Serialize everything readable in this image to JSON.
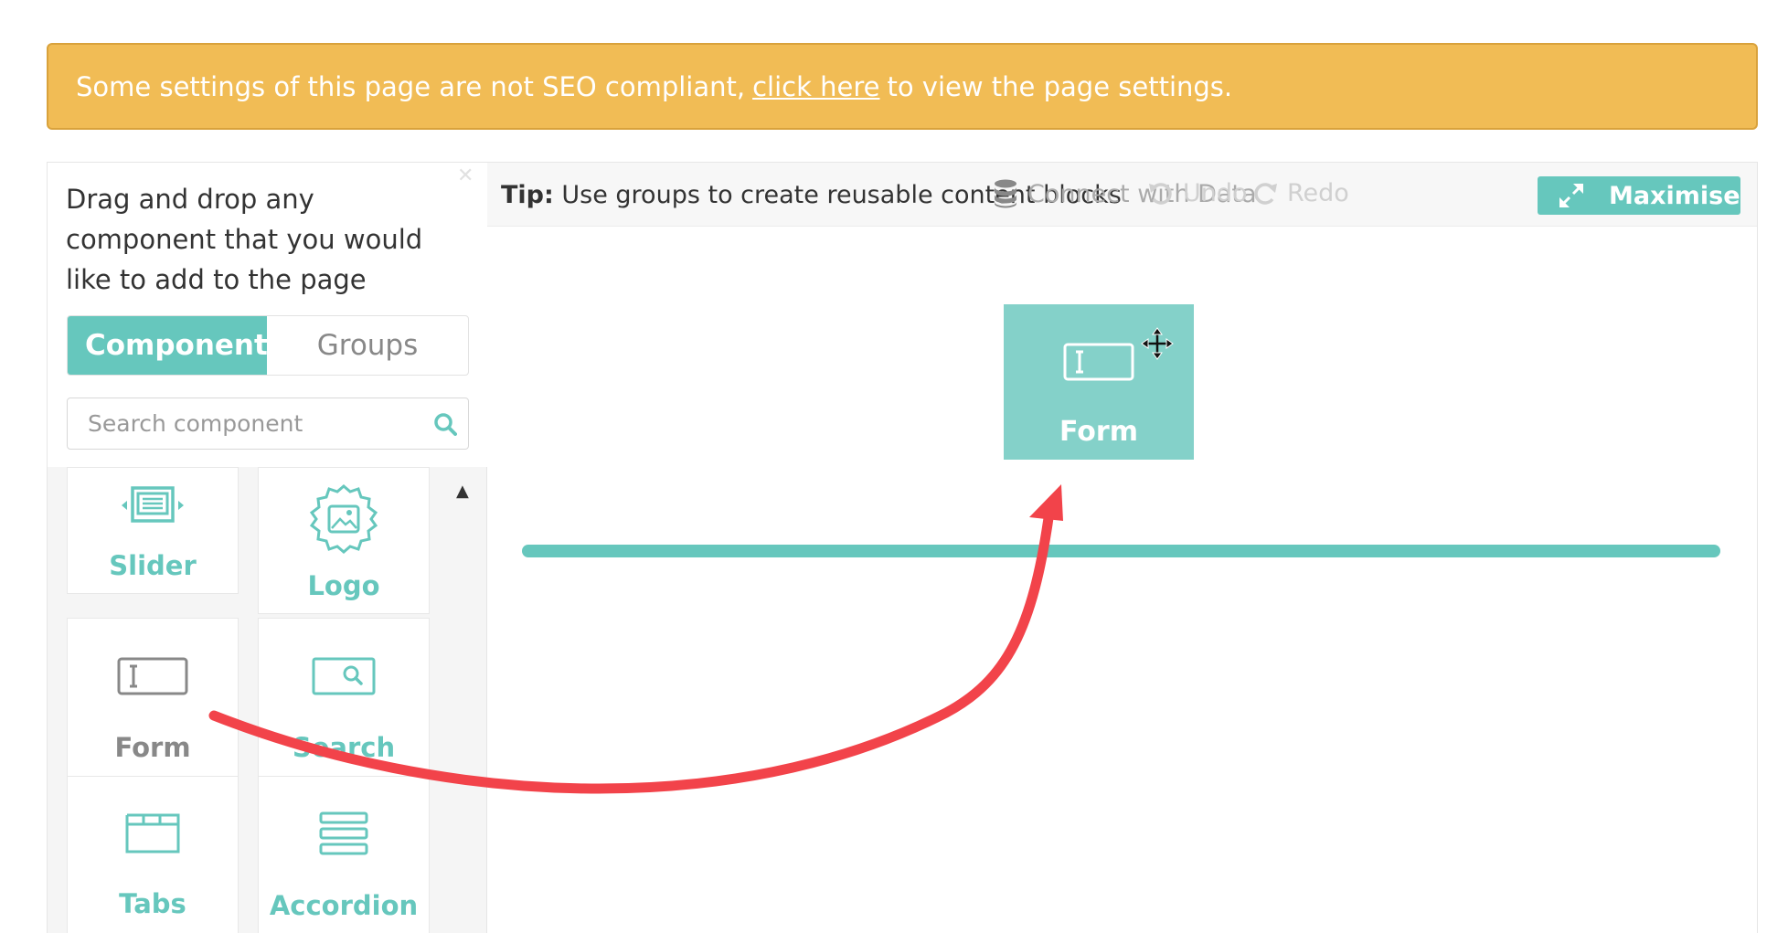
{
  "banner": {
    "text_before": "Some settings of this page are not SEO compliant,",
    "link": "click here",
    "text_after": "to view the page settings.",
    "color": "#f1bc55"
  },
  "panel": {
    "close_icon": "close-icon",
    "intro": "Drag and drop any component that you would like to add to the page",
    "tabs": [
      "Components",
      "Groups"
    ],
    "active_tab": "Components",
    "search": {
      "placeholder": "Search component",
      "value": ""
    },
    "components": [
      {
        "label": "Slider",
        "icon": "slider-icon"
      },
      {
        "label": "Logo",
        "icon": "image-icon"
      },
      {
        "label": "Form",
        "icon": "form-field-icon"
      },
      {
        "label": "Search",
        "icon": "search-field-icon"
      },
      {
        "label": "Tabs",
        "icon": "tabs-icon"
      },
      {
        "label": "Accordion",
        "icon": "accordion-icon"
      }
    ]
  },
  "toolbar": {
    "tip_label": "Tip:",
    "tip_text": "Use groups to create reusable content blocks",
    "connect": "Connect with Data",
    "undo": "Undo",
    "redo": "Redo",
    "maximise": "Maximise"
  },
  "canvas": {
    "dragged_component": "Form",
    "accent_color": "#66c7bd",
    "arrow_color": "#f2434a"
  }
}
